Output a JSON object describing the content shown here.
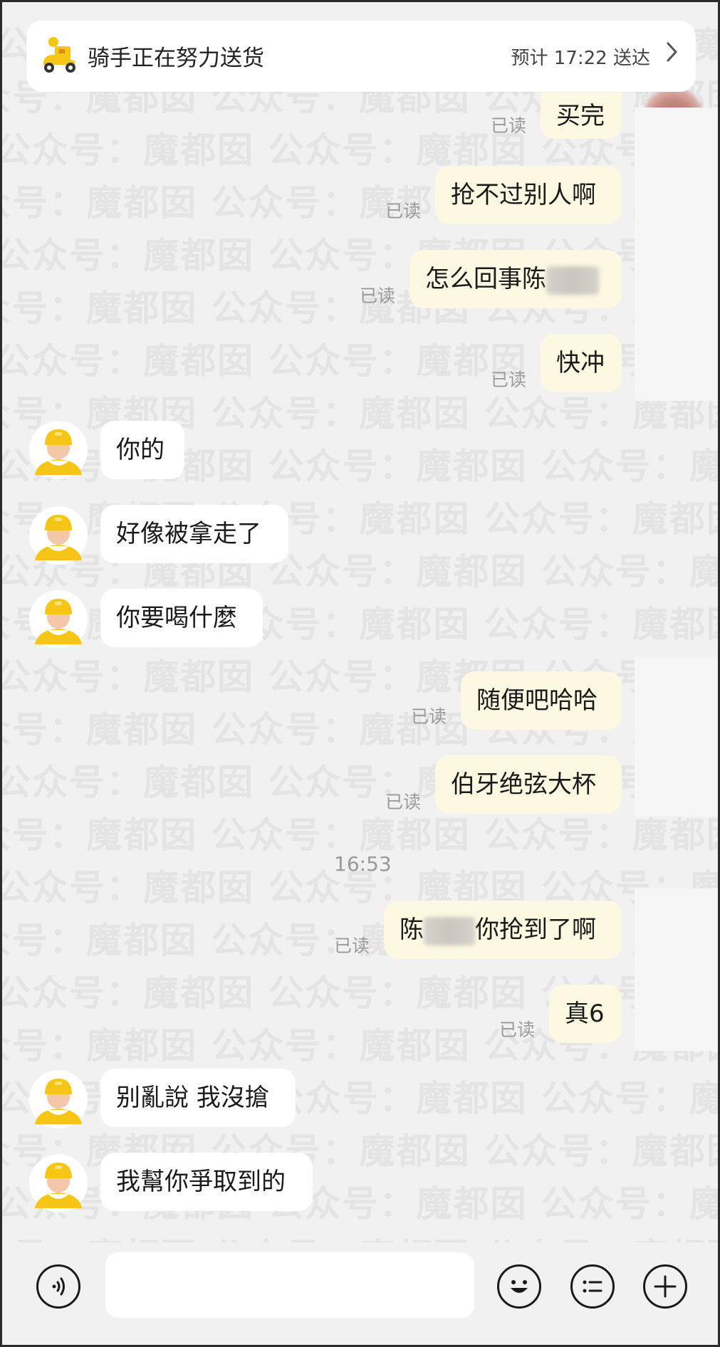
{
  "header": {
    "title": "骑手正在努力送货",
    "eta": "预计 17:22 送达"
  },
  "watermark": {
    "text": "公众号：魔都囡"
  },
  "messages": {
    "m0": {
      "text": "买完",
      "read": "已读"
    },
    "m1": {
      "text": "抢不过别人啊",
      "read": "已读"
    },
    "m2": {
      "text": "怎么回事陈",
      "read": "已读"
    },
    "m3": {
      "text": "快冲",
      "read": "已读"
    },
    "m4": {
      "text": "你的"
    },
    "m5": {
      "text": "好像被拿走了"
    },
    "m6": {
      "text": "你要喝什麼"
    },
    "m7": {
      "text": "随便吧哈哈",
      "read": "已读"
    },
    "m8": {
      "text": "伯牙绝弦大杯",
      "read": "已读"
    },
    "m9_prefix": "陈",
    "m9": {
      "text": "你抢到了啊",
      "read": "已读"
    },
    "m10": {
      "text": "真6",
      "read": "已读"
    },
    "m11": {
      "text": "别亂說 我沒搶"
    },
    "m12": {
      "text": "我幫你爭取到的"
    }
  },
  "timestamp": "16:53",
  "input": {
    "value": "",
    "placeholder": ""
  },
  "colors": {
    "outgoing_bubble": "#fcf8e1",
    "incoming_bubble": "#ffffff",
    "background": "#f1f1f1",
    "rider_yellow": "#f5c518"
  }
}
